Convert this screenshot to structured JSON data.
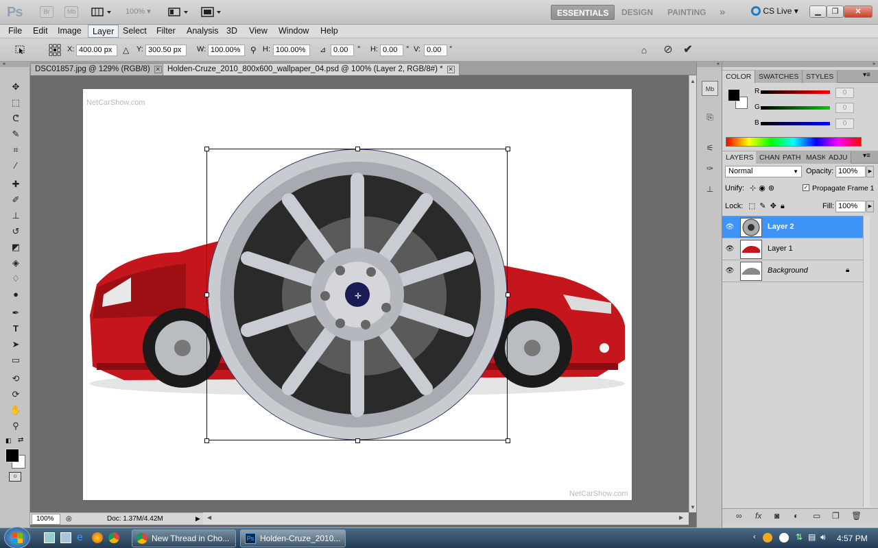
{
  "appbar": {
    "logo": "Ps",
    "bridge": "Br",
    "minibridge": "Mb",
    "zoom": "100%",
    "workspaces": [
      "ESSENTIALS",
      "DESIGN",
      "PAINTING"
    ],
    "more": "»",
    "cslive": "CS Live"
  },
  "menu": [
    "File",
    "Edit",
    "Image",
    "Layer",
    "Select",
    "Filter",
    "Analysis",
    "3D",
    "View",
    "Window",
    "Help"
  ],
  "options": {
    "x_label": "X:",
    "x_value": "400.00 px",
    "y_label": "Y:",
    "y_value": "300.50 px",
    "w_label": "W:",
    "w_value": "100.00%",
    "h_label": "H:",
    "h_value": "100.00%",
    "angle_value": "0.00",
    "hskew_label": "H:",
    "hskew_value": "0.00",
    "vskew_label": "V:",
    "vskew_value": "0.00",
    "deg": "°"
  },
  "tabs": [
    {
      "label": "DSC01857.jpg @ 129% (RGB/8)"
    },
    {
      "label": "Holden-Cruze_2010_800x600_wallpaper_04.psd @ 100% (Layer 2, RGB/8#) *"
    }
  ],
  "canvas": {
    "watermark_top": "NetCarShow.com",
    "watermark_bottom": "NetCarShow.com"
  },
  "status": {
    "zoom": "100%",
    "doc": "Doc: 1.37M/4.42M"
  },
  "color_panel": {
    "tabs": [
      "COLOR",
      "SWATCHES",
      "STYLES"
    ],
    "r_label": "R",
    "g_label": "G",
    "b_label": "B",
    "r_value": "0",
    "g_value": "0",
    "b_value": "0"
  },
  "layers_panel": {
    "tabs": [
      "LAYERS",
      "CHAN",
      "PATH",
      "MASK",
      "ADJU"
    ],
    "blend": "Normal",
    "opacity_label": "Opacity:",
    "opacity": "100%",
    "unify_label": "Unify:",
    "propagate": "Propagate Frame 1",
    "lock_label": "Lock:",
    "fill_label": "Fill:",
    "fill": "100%",
    "layers": [
      {
        "name": "Layer 2"
      },
      {
        "name": "Layer 1"
      },
      {
        "name": "Background"
      }
    ]
  },
  "taskbar": {
    "items": [
      "New Thread in Cho...",
      "Holden-Cruze_2010..."
    ],
    "clock": "4:57 PM"
  }
}
